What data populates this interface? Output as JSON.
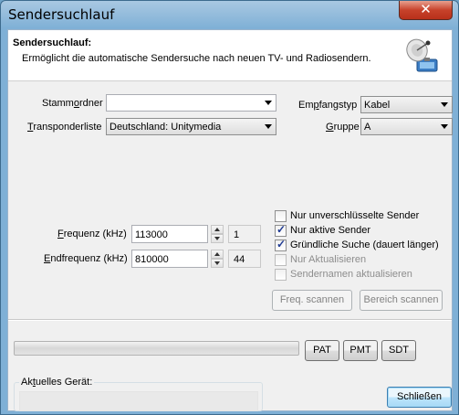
{
  "window": {
    "title": "Sendersuchlauf",
    "close_glyph": "✕"
  },
  "header": {
    "title": "Sendersuchlauf:",
    "description": "Ermöglicht die automatische Sendersuche nach neuen TV- und Radiosendern.",
    "icon": "satellite-dish-icon"
  },
  "form": {
    "stammordner": {
      "pre": "Stamm",
      "acc": "o",
      "post": "rdner",
      "value": ""
    },
    "transponderliste": {
      "pre": "",
      "acc": "T",
      "post": "ransponderliste",
      "value": "Deutschland: Unitymedia"
    },
    "empfangstyp": {
      "pre": "Em",
      "acc": "p",
      "post": "fangstyp",
      "value": "Kabel"
    },
    "gruppe": {
      "pre": "",
      "acc": "G",
      "post": "ruppe",
      "value": "A"
    },
    "frequenz": {
      "pre": "",
      "acc": "F",
      "post": "requenz (kHz)",
      "value": "113000",
      "side": "1"
    },
    "endfrequenz": {
      "pre": "",
      "acc": "E",
      "post": "ndfrequenz (kHz)",
      "value": "810000",
      "side": "44"
    }
  },
  "options": [
    {
      "label": "Nur unverschlüsselte Sender",
      "checked": false,
      "enabled": true
    },
    {
      "label": "Nur aktive Sender",
      "checked": true,
      "enabled": true
    },
    {
      "label": "Gründliche Suche (dauert länger)",
      "checked": true,
      "enabled": true
    },
    {
      "label": "Nur Aktualisieren",
      "checked": false,
      "enabled": false
    },
    {
      "label": "Sendernamen aktualisieren",
      "checked": false,
      "enabled": false
    }
  ],
  "buttons": {
    "freq_scan": "Freq. scannen",
    "range_scan": "Bereich scannen",
    "pat": "PAT",
    "pmt": "PMT",
    "sdt": "SDT",
    "close": "Schließen"
  },
  "progress": {
    "value": 0
  },
  "device": {
    "pre": "Ak",
    "acc": "t",
    "post": "uelles Gerät:",
    "value": ""
  },
  "check_glyph": "✓"
}
